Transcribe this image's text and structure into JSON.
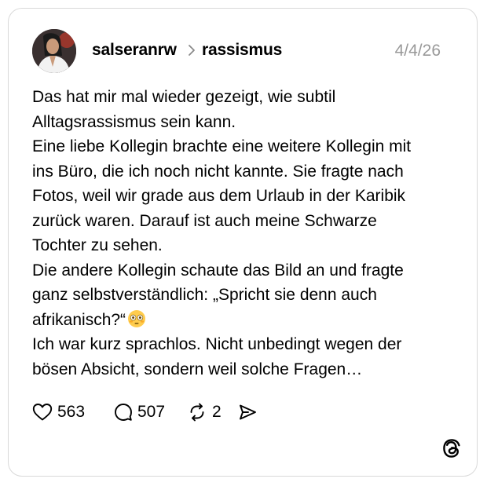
{
  "post": {
    "username": "salseranrw",
    "topic": "rassismus",
    "date": "4/4/26",
    "avatar_icon": "profile-photo-avatar",
    "text": {
      "p1": "Das hat mir mal wieder gezeigt, wie subtil\nAlltagsrassismus sein kann.",
      "p2": "Eine liebe Kollegin brachte eine weitere Kollegin mit\nins Büro, die ich noch nicht kannte. Sie fragte nach\nFotos, weil wir grade aus dem Urlaub in der Karibik\nzurück waren. Darauf ist auch meine Schwarze\nTochter zu sehen.",
      "p3": "Die andere Kollegin schaute das Bild an und fragte\nganz selbstverständlich: „Spricht sie denn auch\nafrikanisch?“",
      "p3_emoji": "flushed-face-emoji",
      "p4": "Ich war kurz sprachlos. Nicht unbedingt wegen der\nbösen Absicht, sondern weil solche Fragen…"
    }
  },
  "actions": {
    "likes": "563",
    "comments": "507",
    "reposts": "2",
    "like_icon": "heart-icon",
    "comment_icon": "speech-bubble-icon",
    "repost_icon": "repost-arrows-icon",
    "share_icon": "send-arrow-icon"
  },
  "branding": {
    "logo_icon": "threads-logo-icon"
  },
  "colors": {
    "text": "#000000",
    "muted": "#999999",
    "border": "#d9d9d9",
    "background": "#ffffff"
  }
}
